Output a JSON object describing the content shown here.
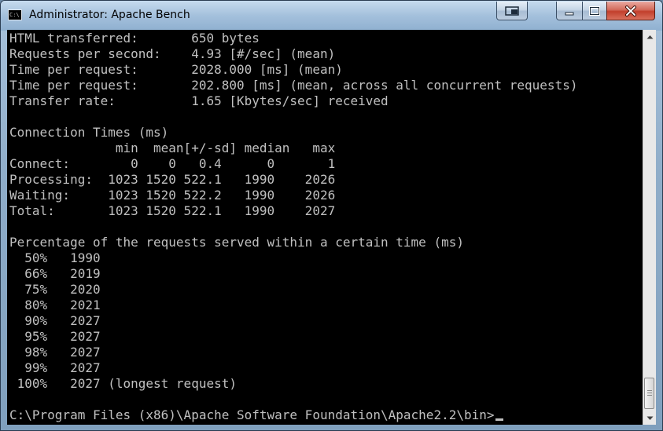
{
  "window": {
    "title": "Administrator: Apache Bench",
    "icon_text": "C:\\"
  },
  "console": {
    "lines": [
      "HTML transferred:       650 bytes",
      "Requests per second:    4.93 [#/sec] (mean)",
      "Time per request:       2028.000 [ms] (mean)",
      "Time per request:       202.800 [ms] (mean, across all concurrent requests)",
      "Transfer rate:          1.65 [Kbytes/sec] received",
      "",
      "Connection Times (ms)",
      "              min  mean[+/-sd] median   max",
      "Connect:        0    0   0.4      0       1",
      "Processing:  1023 1520 522.1   1990    2026",
      "Waiting:     1023 1520 522.2   1990    2026",
      "Total:       1023 1520 522.1   1990    2027",
      "",
      "Percentage of the requests served within a certain time (ms)",
      "  50%   1990",
      "  66%   2019",
      "  75%   2020",
      "  80%   2021",
      "  90%   2027",
      "  95%   2027",
      "  98%   2027",
      "  99%   2027",
      " 100%   2027 (longest request)",
      "",
      "C:\\Program Files (x86)\\Apache Software Foundation\\Apache2.2\\bin>"
    ]
  },
  "colors": {
    "console_bg": "#000000",
    "console_fg": "#c0c0c0",
    "close_button": "#c94a36"
  },
  "icons": {
    "app": "console-icon",
    "extra": "snap-icon",
    "minimize": "minimize-icon",
    "maximize": "maximize-icon",
    "close": "close-icon",
    "scroll_up": "scroll-up-arrow-icon",
    "scroll_down": "scroll-down-arrow-icon"
  }
}
